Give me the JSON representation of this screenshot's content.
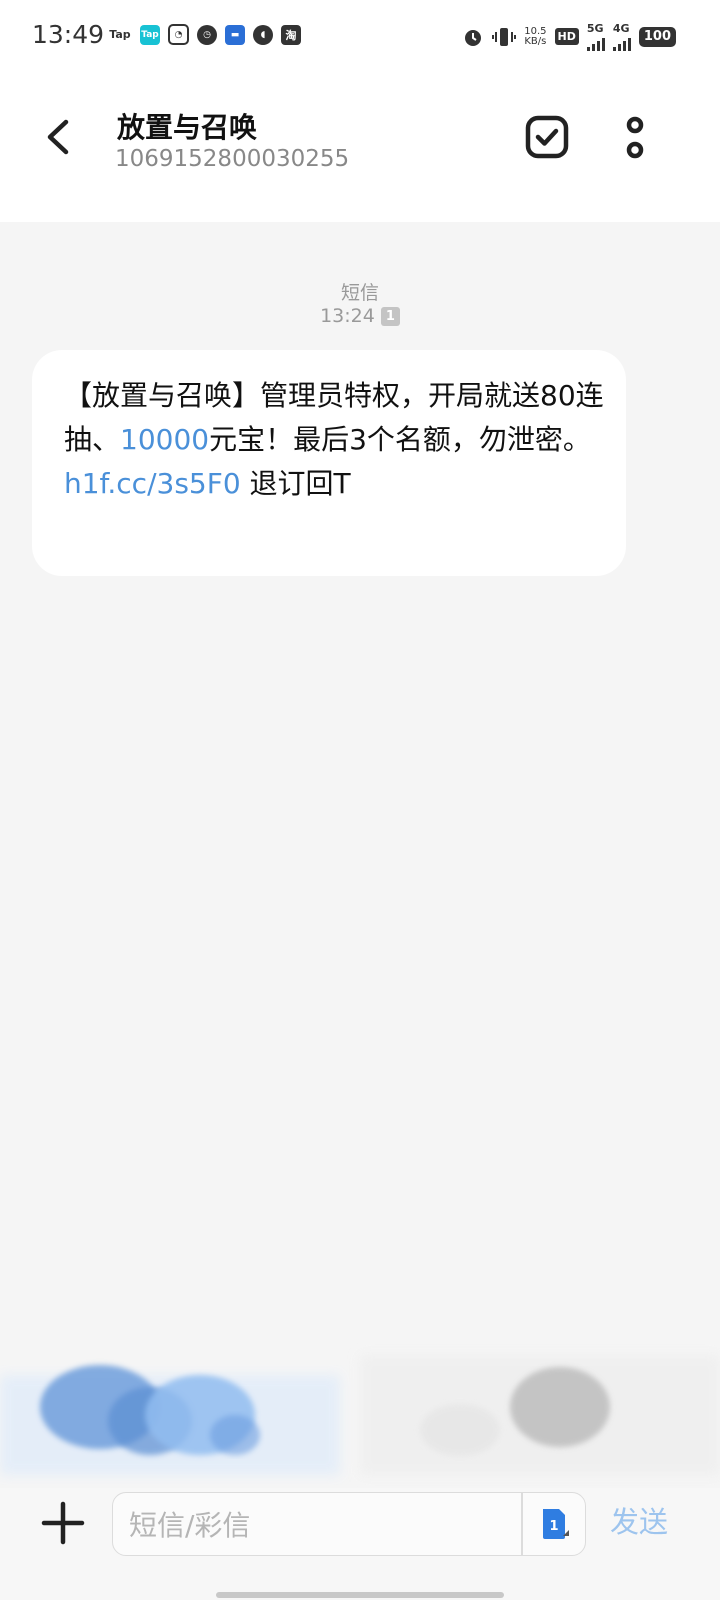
{
  "status_bar": {
    "time": "13:49",
    "left_icons": [
      {
        "name": "taptap-icon",
        "label": "Tap"
      },
      {
        "name": "taptap-app-icon",
        "label": "Tap"
      },
      {
        "name": "dingtalk-icon",
        "label": ""
      },
      {
        "name": "speedometer-icon",
        "label": ""
      },
      {
        "name": "car-app-icon",
        "label": ""
      },
      {
        "name": "quark-icon",
        "label": ""
      },
      {
        "name": "taobao-icon",
        "label": "淘"
      }
    ],
    "speed_value": "10.5",
    "speed_unit": "KB/s",
    "hd_label": "HD",
    "sim1_network": "5G",
    "sim2_network": "4G",
    "battery": "100"
  },
  "header": {
    "contact_name": "放置与召唤",
    "contact_number": "1069152800030255"
  },
  "message": {
    "type_label": "短信",
    "time": "13:24",
    "sim_badge": "1",
    "parts": {
      "p1": "【放置与召唤】管理员特权，开局就送80连抽、",
      "link_number": "10000",
      "p2": "元宝！最后3个名额，勿泄密。",
      "link_url": "h1f.cc/3s5F0",
      "p3": " 退订回T"
    }
  },
  "input_bar": {
    "placeholder": "短信/彩信",
    "sim_label": "1",
    "send_label": "发送"
  },
  "colors": {
    "link": "#4a90d9",
    "send_disabled": "#9dc4ee",
    "background": "#f5f5f5"
  }
}
